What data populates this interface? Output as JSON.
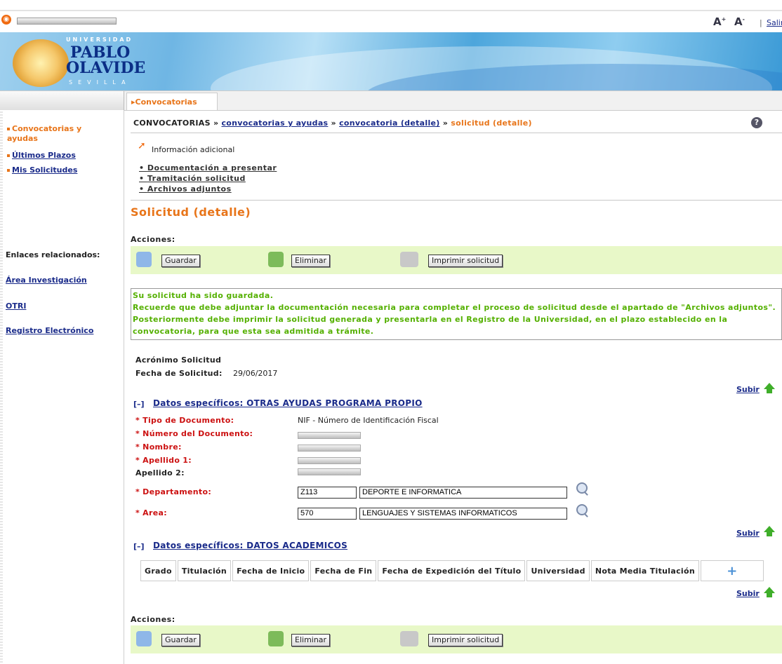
{
  "topbar": {
    "font_increase": "A",
    "font_decrease": "A",
    "salir": "Salir"
  },
  "logo": {
    "universidad": "UNIVERSIDAD",
    "pablo": "PABLO",
    "olavide": "OLAVIDE",
    "sevilla": "SEVILLA"
  },
  "tab": {
    "label": "Convocatorias"
  },
  "sidebar": {
    "items": [
      {
        "label": "Convocatorias y ayudas"
      },
      {
        "label": "Últimos Plazos"
      },
      {
        "label": "Mis Solicitudes"
      }
    ],
    "related_title": "Enlaces relacionados:",
    "related": [
      "Área Investigación",
      "OTRI",
      "Registro Electrónico"
    ]
  },
  "breadcrumb": {
    "root": "CONVOCATORIAS",
    "sep": "»",
    "link1": "convocatorias y ayudas",
    "link2": "convocatoria (detalle)",
    "current": "solicitud (detalle)"
  },
  "info": {
    "label": "Información adicional",
    "links": [
      "Documentación a presentar",
      "Tramitación solicitud",
      "Archivos adjuntos"
    ]
  },
  "page_title": "Solicitud (detalle)",
  "actions": {
    "label": "Acciones:",
    "guardar": "Guardar",
    "eliminar": "Eliminar",
    "imprimir": "Imprimir solicitud"
  },
  "message": {
    "lines": [
      "Su solicitud ha sido guardada.",
      "Recuerde que debe adjuntar la documentación necesaria para completar el proceso de solicitud desde el apartado de \"Archivos adjuntos\".",
      "Posteriormente debe imprimir la solicitud generada y presentarla en el Registro de la Universidad, en el plazo establecido en la",
      "convocatoria, para que esta sea admitida a trámite."
    ]
  },
  "summary": {
    "acronimo_label": "Acrónimo Solicitud",
    "fecha_label": "Fecha de Solicitud:",
    "fecha_value": "29/06/2017"
  },
  "subir": "Subir",
  "section1": {
    "toggle": "[–]",
    "title": "Datos específicos: OTRAS AYUDAS PROGRAMA PROPIO",
    "fields": {
      "tipo_label": "* Tipo de Documento:",
      "tipo_value": "NIF - Número de Identificación Fiscal",
      "numero_label": "* Número del Documento:",
      "nombre_label": "* Nombre:",
      "apellido1_label": "* Apellido 1:",
      "apellido2_label": "Apellido 2:",
      "departamento_label": "* Departamento:",
      "departamento_code": "Z113",
      "departamento_name": "DEPORTE E INFORMATICA",
      "area_label": "* Area:",
      "area_code": "570",
      "area_name": "LENGUAJES Y SISTEMAS INFORMATICOS"
    }
  },
  "section2": {
    "toggle": "[–]",
    "title": "Datos específicos: DATOS ACADEMICOS",
    "columns": [
      "Grado",
      "Titulación",
      "Fecha de Inicio",
      "Fecha de Fin",
      "Fecha de Expedición del Título",
      "Universidad",
      "Nota Media Titulación"
    ],
    "add": "+"
  },
  "colors": {
    "orange": "#e8751a",
    "blue": "#1a2b8a",
    "green_text": "#54b000",
    "action_bg": "#e8f8c8",
    "required": "#cc1111"
  }
}
